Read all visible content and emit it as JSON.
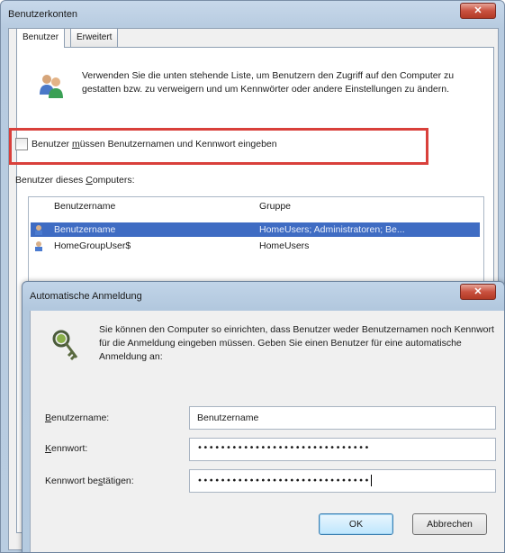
{
  "window": {
    "title": "Benutzerkonten"
  },
  "tabs": [
    {
      "label": "Benutzer"
    },
    {
      "label": "Erweitert"
    }
  ],
  "description": "Verwenden Sie die unten stehende Liste, um Benutzern den Zugriff auf den Computer zu gestatten bzw. zu verweigern und um Kennwörter oder andere Einstellungen zu ändern.",
  "require_password": {
    "label_pre": "Benutzer ",
    "label_u": "m",
    "label_post": "üssen Benutzernamen und Kennwort eingeben",
    "checked": false
  },
  "users_group": {
    "label_pre": "Benutzer dieses ",
    "label_u": "C",
    "label_post": "omputers:"
  },
  "table": {
    "columns": [
      "Benutzername",
      "Gruppe"
    ],
    "rows": [
      {
        "name": "Benutzername",
        "group": "HomeUsers; Administratoren; Be...",
        "selected": true
      },
      {
        "name": "HomeGroupUser$",
        "group": "HomeUsers",
        "selected": false
      }
    ]
  },
  "autologon": {
    "title": "Automatische Anmeldung",
    "description": "Sie können den Computer so einrichten, dass Benutzer weder Benutzernamen noch Kennwort für die Anmeldung eingeben müssen. Geben Sie einen Benutzer für eine automatische Anmeldung an:",
    "fields": {
      "username": {
        "label_u": "B",
        "label_rest": "enutzername:",
        "value": "Benutzername"
      },
      "password": {
        "label_u": "K",
        "label_rest": "ennwort:",
        "value": "••••••••••••••••••••••••••••••"
      },
      "confirm": {
        "label_pre": "Kennwort be",
        "label_u": "s",
        "label_post": "tätigen:",
        "value": "••••••••••••••••••••••••••••••"
      }
    },
    "ok_label": "OK",
    "cancel_label": "Abbrechen"
  },
  "colors": {
    "highlight": "#d9403b",
    "selection": "#3f6cc3"
  }
}
